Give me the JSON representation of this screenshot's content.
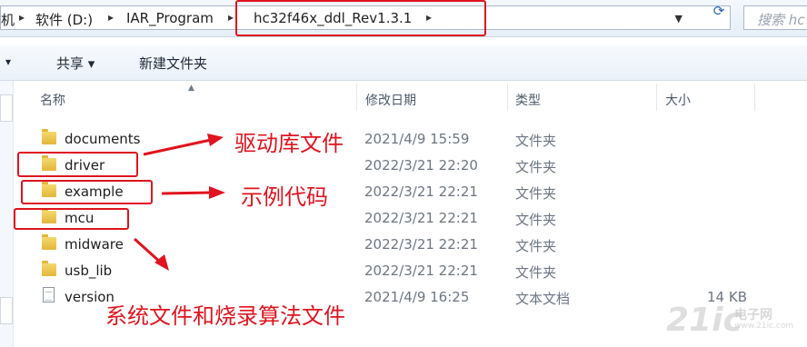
{
  "address": {
    "prefix": "机",
    "drive": "软件 (D:)",
    "folder1": "IAR_Program",
    "folder2": "hc32f46x_ddl_Rev1.3.1",
    "search_placeholder": "搜索 hc"
  },
  "toolbar": {
    "share": "共享 ▾",
    "new_folder": "新建文件夹",
    "left_arrow": "▾"
  },
  "columns": {
    "name": "名称",
    "date": "修改日期",
    "type": "类型",
    "size": "大小"
  },
  "files": [
    {
      "name": "documents",
      "date": "2021/4/9 15:59",
      "type": "文件夹",
      "size": "",
      "icon": "folder-icon"
    },
    {
      "name": "driver",
      "date": "2022/3/21 22:20",
      "type": "文件夹",
      "size": "",
      "icon": "folder-icon"
    },
    {
      "name": "example",
      "date": "2022/3/21 22:21",
      "type": "文件夹",
      "size": "",
      "icon": "folder-icon"
    },
    {
      "name": "mcu",
      "date": "2022/3/21 22:21",
      "type": "文件夹",
      "size": "",
      "icon": "folder-icon"
    },
    {
      "name": "midware",
      "date": "2022/3/21 22:21",
      "type": "文件夹",
      "size": "",
      "icon": "folder-icon"
    },
    {
      "name": "usb_lib",
      "date": "2022/3/21 22:21",
      "type": "文件夹",
      "size": "",
      "icon": "folder-icon"
    },
    {
      "name": "version",
      "date": "2021/4/9 16:25",
      "type": "文本文档",
      "size": "14 KB",
      "icon": "text-document-icon"
    }
  ],
  "annotations": {
    "driver_label": "驱动库文件",
    "example_label": "示例代码",
    "mcu_label": "系统文件和烧录算法文件",
    "accent_color": "#e0141e"
  },
  "watermark": {
    "main": "21ic",
    "sub": "电子网",
    "url": "www.21ic.com"
  }
}
